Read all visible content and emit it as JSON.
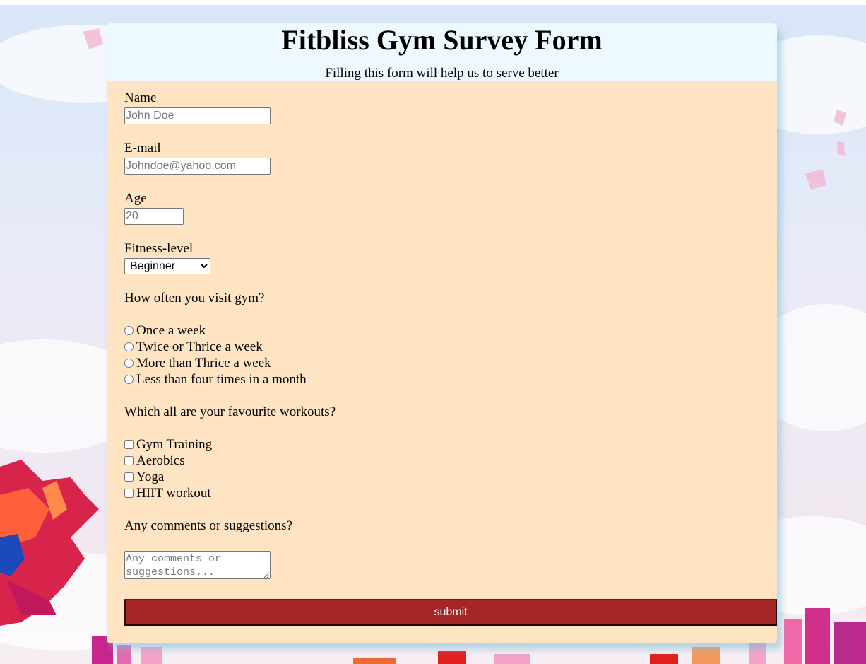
{
  "header": {
    "title": "Fitbliss Gym Survey Form",
    "subtitle": "Filling this form will help us to serve better"
  },
  "form": {
    "name": {
      "label": "Name",
      "placeholder": "John Doe",
      "value": ""
    },
    "email": {
      "label": "E-mail",
      "placeholder": "Johndoe@yahoo.com",
      "value": ""
    },
    "age": {
      "label": "Age",
      "placeholder": "20",
      "value": ""
    },
    "fitness": {
      "label": "Fitness-level",
      "selected": "Beginner"
    },
    "frequency": {
      "question": "How often you visit gym?",
      "options": [
        "Once a week",
        "Twice or Thrice a week",
        "More than Thrice a week",
        "Less than four times in a month"
      ]
    },
    "workouts": {
      "question": "Which all are your favourite workouts?",
      "options": [
        "Gym Training",
        "Aerobics",
        "Yoga",
        "HIIT workout"
      ]
    },
    "comments": {
      "question": "Any comments or suggestions?",
      "placeholder": "Any comments or suggestions..."
    },
    "submit_label": "submit"
  },
  "colors": {
    "card_background": "#ffe4c4",
    "header_background": "#eef8ff",
    "submit_background": "#a52626",
    "submit_text": "#ffffff"
  }
}
